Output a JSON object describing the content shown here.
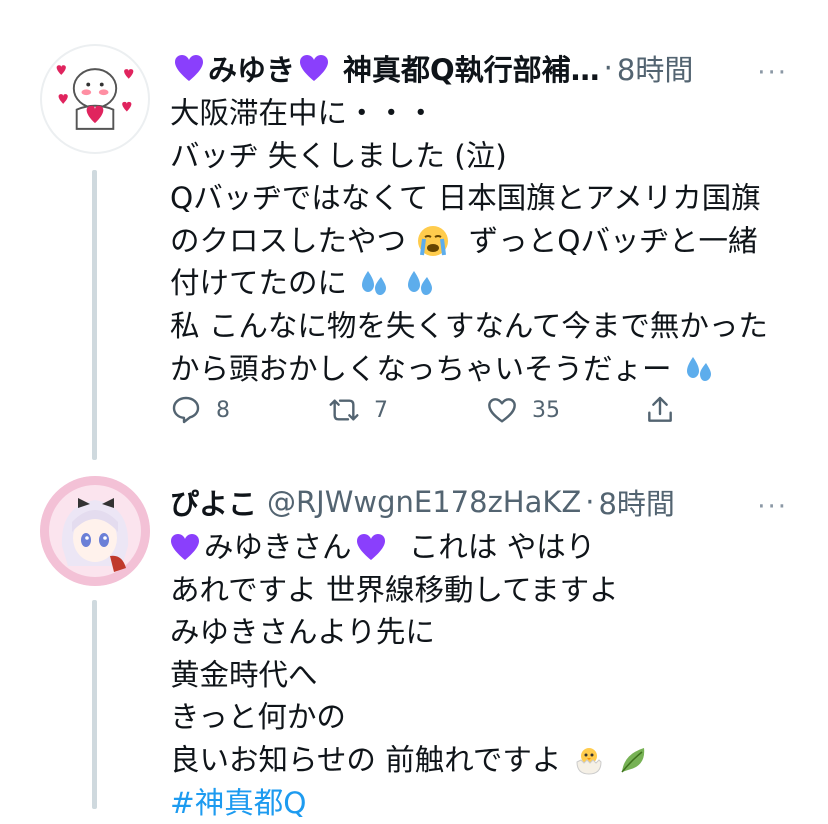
{
  "tweets": [
    {
      "author_name": "みゆき",
      "handle": "神真都Q執行部補…",
      "separator": "·",
      "time": "8時間",
      "more": "···",
      "lines": [
        "大阪滞在中に・・・",
        "バッヂ 失くしました (泣)",
        "Qバッヂではなくて 日本国旗とアメリカ国旗",
        "のクロスしたやつ",
        "ずっとQバッヂと一緒",
        "付けてたのに",
        "私 こんなに物を失くすなんて今まで無かった",
        "から頭おかしくなっちゃいそうだょー"
      ],
      "actions": {
        "replies": "8",
        "retweets": "7",
        "likes": "35"
      }
    },
    {
      "author_name": "ぴよこ",
      "handle": "@RJWwgnE178zHaKZ",
      "separator": "·",
      "time": "8時間",
      "more": "···",
      "mention": "みゆきさん",
      "lines": [
        "これは やはり",
        "あれですよ 世界線移動してますよ",
        "みゆきさんより先に",
        "黄金時代へ",
        "きっと何かの",
        "良いお知らせの 前触れですよ"
      ],
      "hashtag": "#神真都Q"
    }
  ],
  "colors": {
    "text": "#0f1419",
    "muted": "#536471",
    "accent": "#1d9bf0",
    "purple_heart": "#8a3ffc"
  },
  "icons": [
    "purple-heart-icon",
    "crying-face-icon",
    "sweat-droplets-icon",
    "hatching-chick-icon",
    "leaf-icon",
    "reply-icon",
    "retweet-icon",
    "like-icon",
    "share-icon"
  ]
}
